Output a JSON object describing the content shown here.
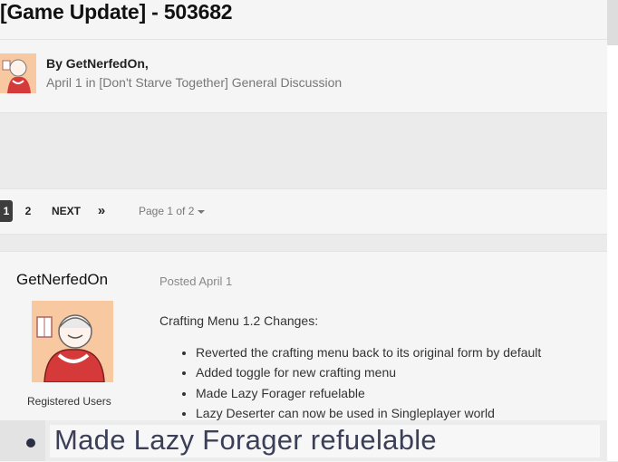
{
  "topic": {
    "title": "[Game Update] - 503682",
    "by_label": "By GetNerfedOn,",
    "meta": {
      "date": "April 1",
      "in_label": "in",
      "forum": "[Don't Starve Together] General Discussion"
    }
  },
  "pagination": {
    "current": "1",
    "page2": "2",
    "next": "NEXT",
    "last": "»",
    "info": "Page 1 of 2"
  },
  "post": {
    "author": "GetNerfedOn",
    "group": "Registered Users",
    "posted": "Posted April 1",
    "intro": "Crafting Menu 1.2 Changes:",
    "items": [
      "Reverted the crafting menu back to its original form by default",
      "Added toggle for new crafting menu",
      "Made Lazy Forager refuelable",
      "Lazy Deserter can now be used in Singleplayer world"
    ]
  },
  "zoom_overlay": {
    "text": "Made Lazy Forager refuelable"
  },
  "colors": {
    "pager_active": "#3d3d3d",
    "avatar_bg": "#f8c9a0",
    "avatar_red": "#d6393a"
  }
}
